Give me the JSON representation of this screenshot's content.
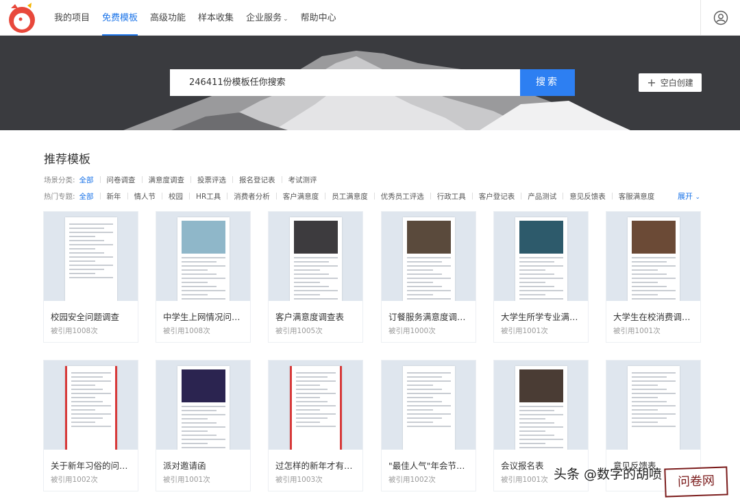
{
  "nav": {
    "items": [
      {
        "label": "我的项目",
        "active": false
      },
      {
        "label": "免费模板",
        "active": true
      },
      {
        "label": "高级功能",
        "active": false
      },
      {
        "label": "样本收集",
        "active": false
      },
      {
        "label": "企业服务",
        "active": false
      },
      {
        "label": "帮助中心",
        "active": false
      }
    ],
    "dropdown_icon": "chevron-down-icon",
    "user_icon": "user-icon"
  },
  "hero": {
    "search_placeholder": "246411份模板任你搜索",
    "search_button": "搜索",
    "blank_create": "空白创建"
  },
  "section": {
    "title": "推荐模板",
    "scene_label": "场景分类:",
    "scene_items": [
      "全部",
      "问卷调查",
      "满意度调查",
      "投票评选",
      "报名登记表",
      "考试测评"
    ],
    "topic_label": "热门专题:",
    "topic_items": [
      "全部",
      "新年",
      "情人节",
      "校园",
      "HR工具",
      "消费者分析",
      "客户满意度",
      "员工满意度",
      "优秀员工评选",
      "行政工具",
      "客户登记表",
      "产品测试",
      "意见反馈表",
      "客服满意度"
    ],
    "expand": "展开"
  },
  "cards": [
    {
      "title": "校园安全问题调查",
      "uses": "被引用1008次",
      "photo": ""
    },
    {
      "title": "中学生上网情况问卷...",
      "uses": "被引用1008次",
      "photo": "#8fb7c9"
    },
    {
      "title": "客户满意度调查表",
      "uses": "被引用1005次",
      "photo": "#3d3b3e"
    },
    {
      "title": "订餐服务满意度调查...",
      "uses": "被引用1000次",
      "photo": "#5a4a3c"
    },
    {
      "title": "大学生所学专业满意...",
      "uses": "被引用1001次",
      "photo": "#2d5a6b"
    },
    {
      "title": "大学生在校消费调查表",
      "uses": "被引用1001次",
      "photo": "#6b4a36"
    },
    {
      "title": "关于新年习俗的问卷...",
      "uses": "被引用1002次",
      "photo": "",
      "red": true
    },
    {
      "title": "派对邀请函",
      "uses": "被引用1001次",
      "photo": "#2b2450"
    },
    {
      "title": "过怎样的新年才有意义",
      "uses": "被引用1003次",
      "photo": "",
      "red": true
    },
    {
      "title": "\"最佳人气\"年会节目...",
      "uses": "被引用1002次",
      "photo": ""
    },
    {
      "title": "会议报名表",
      "uses": "被引用1001次",
      "photo": "#4a3c34"
    },
    {
      "title": "意见反馈表",
      "uses": "",
      "photo": ""
    }
  ],
  "watermark": {
    "text": "头条 @数字的胡喷",
    "stamp": "问卷网"
  }
}
